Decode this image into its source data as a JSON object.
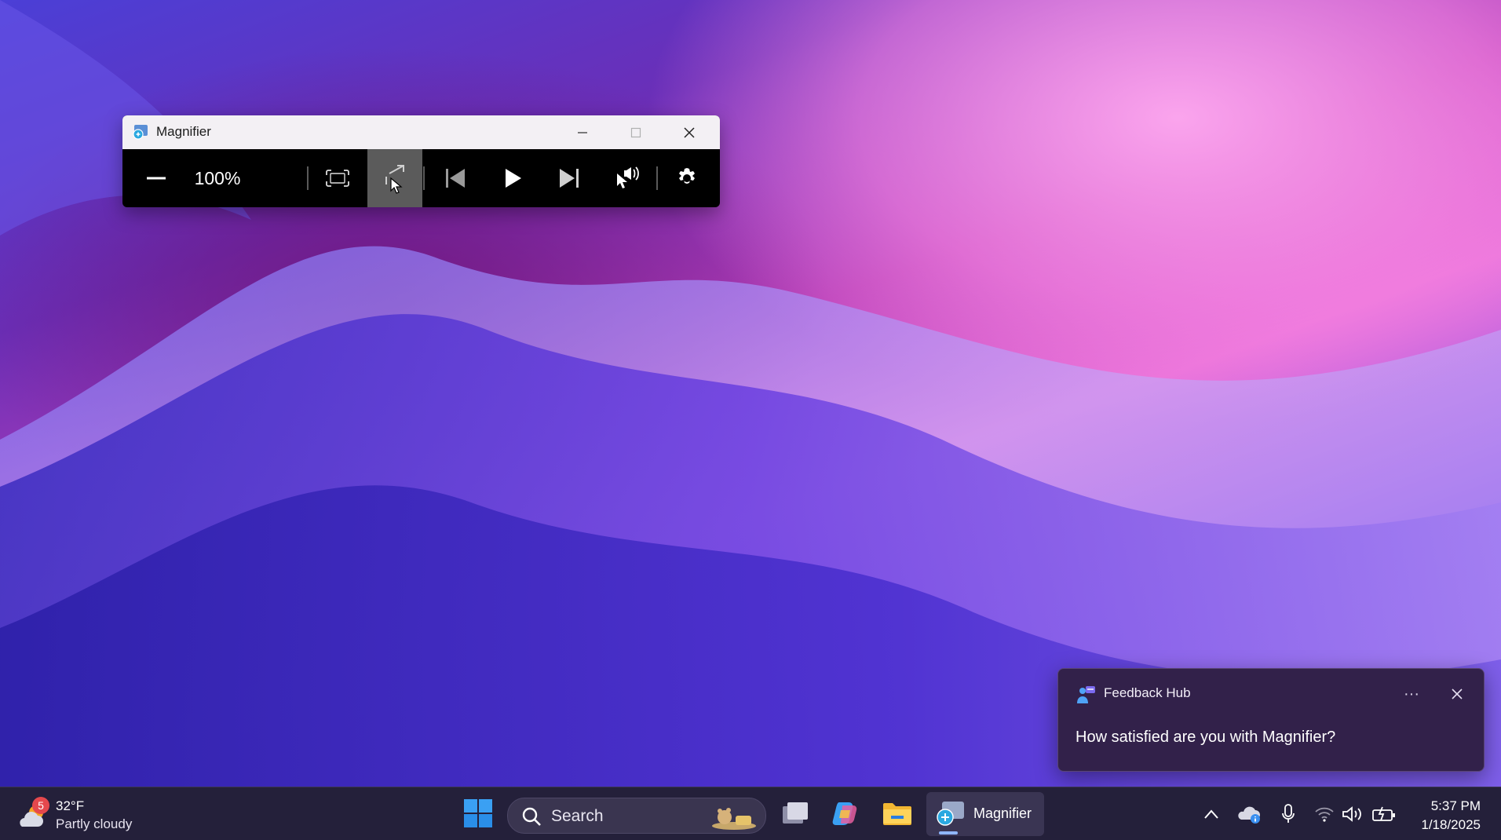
{
  "colors": {
    "taskbar_bg": "#24203a",
    "toast_bg": "#32214a",
    "toolbar_bg": "#000000",
    "hover_button": "#5b5b5b"
  },
  "magnifier": {
    "title": "Magnifier",
    "zoom_level": "100%",
    "icons": [
      "zoom-out-icon",
      "zoom-in-icon",
      "fullscreen-view-icon",
      "docked-view-icon",
      "previous-paragraph-icon",
      "play-icon",
      "next-paragraph-icon",
      "read-from-here-icon",
      "settings-icon"
    ]
  },
  "taskbar": {
    "weather": {
      "badge": "5",
      "temperature": "32°F",
      "condition": "Partly cloudy"
    },
    "search_label": "Search",
    "running_app_label": "Magnifier",
    "clock": {
      "time": "5:37 PM",
      "date": "1/18/2025"
    }
  },
  "notification": {
    "app_name": "Feedback Hub",
    "more_label": "···",
    "message": "How satisfied are you with Magnifier?"
  }
}
